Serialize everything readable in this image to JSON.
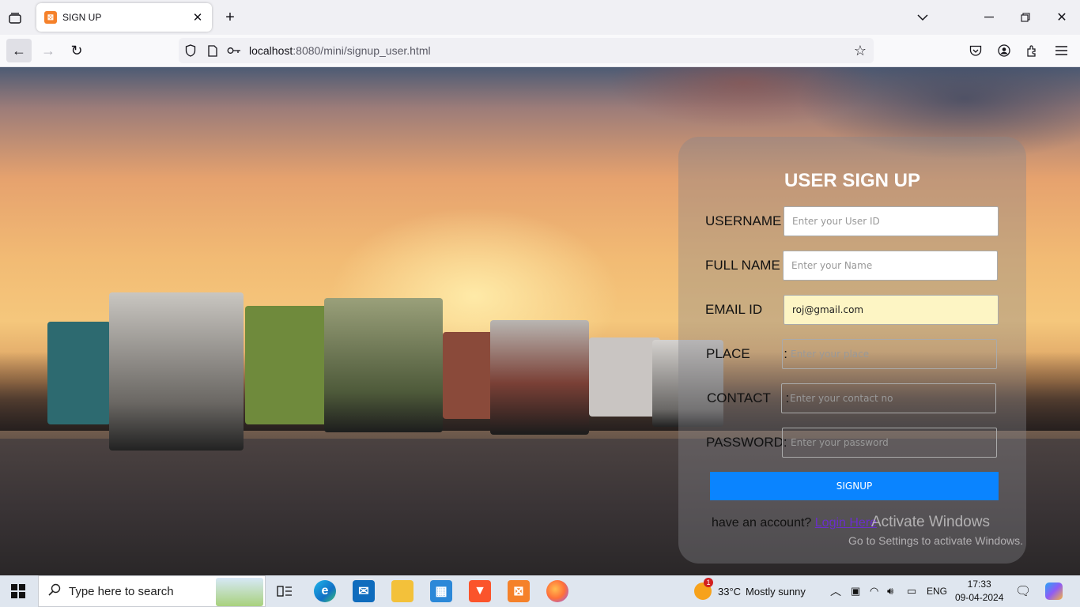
{
  "browser": {
    "tab_title": "SIGN UP",
    "url_host": "localhost",
    "url_rest": ":8080/mini/signup_user.html"
  },
  "form": {
    "heading": "USER SIGN UP",
    "fields": [
      {
        "label": "USERNAME :",
        "placeholder": "Enter your User ID",
        "value": ""
      },
      {
        "label": "FULL NAME :",
        "placeholder": "Enter your Name",
        "value": ""
      },
      {
        "label": "EMAIL ID      :",
        "placeholder": "",
        "value": "roj@gmail.com"
      },
      {
        "label": "PLACE         :",
        "placeholder": "Enter your place",
        "value": ""
      },
      {
        "label": "CONTACT    :",
        "placeholder": "Enter your contact no",
        "value": ""
      },
      {
        "label": "PASSWORD:",
        "placeholder": "Enter your password",
        "value": ""
      }
    ],
    "submit_label": "SIGNUP",
    "have_account": "have an account?",
    "login_link": "Login Here"
  },
  "watermark": {
    "line1": "Activate Windows",
    "line2": "Go to Settings to activate Windows."
  },
  "taskbar": {
    "search_placeholder": "Type here to search",
    "weather_temp": "33°C",
    "weather_text": "Mostly sunny",
    "weather_badge": "1",
    "language": "ENG",
    "time": "17:33",
    "date": "09-04-2024"
  },
  "colors": {
    "accent": "#0a84ff",
    "link": "#6a2fc9",
    "autofill": "#fdf5c4"
  }
}
